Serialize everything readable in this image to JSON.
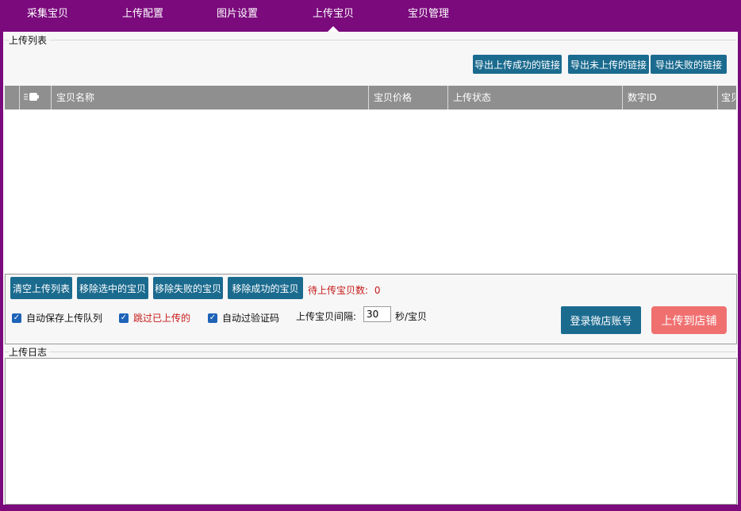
{
  "nav": {
    "tabs": [
      {
        "label": "采集宝贝"
      },
      {
        "label": "上传配置"
      },
      {
        "label": "图片设置"
      },
      {
        "label": "上传宝贝"
      },
      {
        "label": "宝贝管理"
      }
    ],
    "active_index": 3
  },
  "upload_list": {
    "title": "上传列表",
    "export_success": "导出上传成功的链接",
    "export_not_uploaded": "导出未上传的链接",
    "export_failed": "导出失败的链接",
    "columns": [
      "宝贝名称",
      "宝贝价格",
      "上传状态",
      "数字ID",
      "宝贝"
    ],
    "rows": []
  },
  "controls": {
    "clear_list": "清空上传列表",
    "remove_selected": "移除选中的宝贝",
    "remove_failed": "移除失败的宝贝",
    "remove_success": "移除成功的宝贝",
    "pending_label": "待上传宝贝数:",
    "pending_count": "0",
    "auto_save": "自动保存上传队列",
    "skip_uploaded": "跳过已上传的",
    "auto_captcha": "自动过验证码",
    "interval_label": "上传宝贝间隔:",
    "interval_value": "30",
    "interval_unit": "秒/宝贝",
    "login_button": "登录微店账号",
    "upload_button": "上传到店铺"
  },
  "log": {
    "title": "上传日志"
  },
  "colors": {
    "frame": "#7b0a7d",
    "button": "#1b6b8f",
    "upload_button": "#f07070",
    "header": "#8f8f8f"
  }
}
